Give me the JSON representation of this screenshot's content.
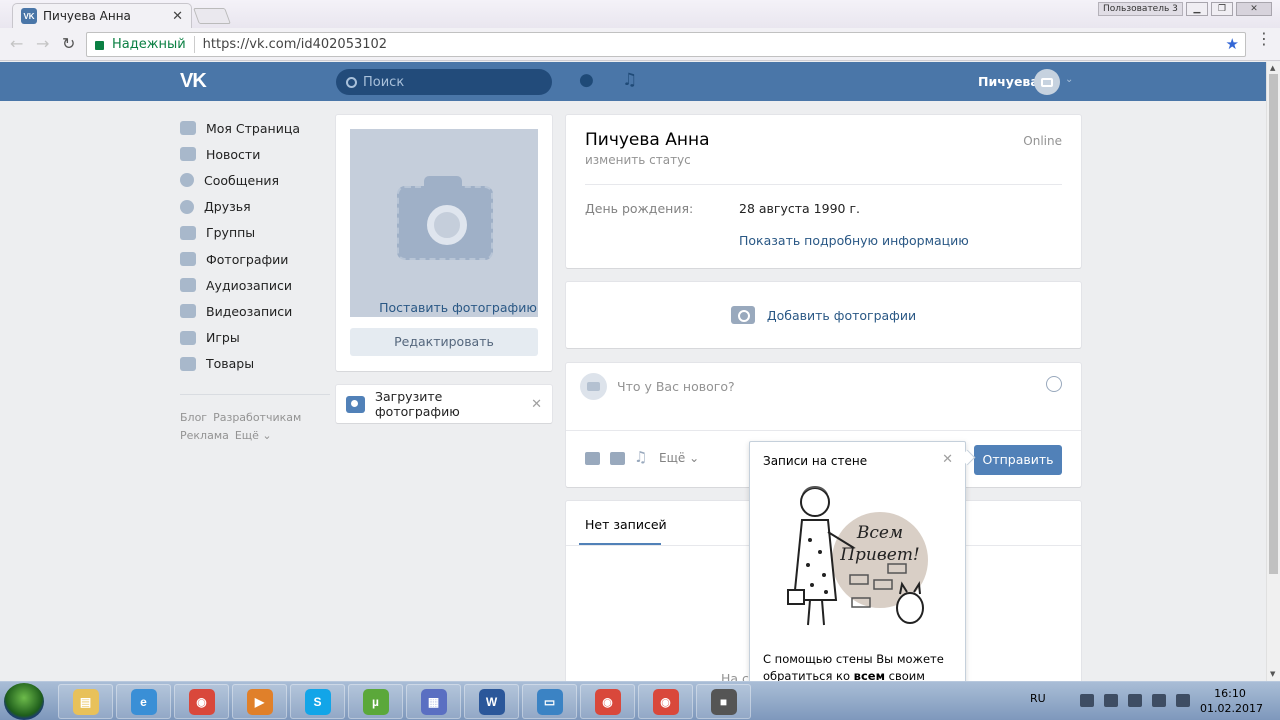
{
  "browser": {
    "tab_title": "Пичуева Анна",
    "tab_close": "✕",
    "favicon_text": "VK",
    "user_badge": "Пользователь 3",
    "secure_label": "Надежный",
    "url": "https://vk.com/id402053102",
    "back_icon": "←",
    "forward_icon": "→",
    "reload_icon": "↻",
    "star_icon": "★",
    "menu_icon": "⋮",
    "window_min": "▁",
    "window_max": "❐",
    "window_close": "✕"
  },
  "header": {
    "logo": "VK",
    "search_placeholder": "Поиск",
    "bell_icon": "🔔",
    "music_icon": "♫",
    "user_name": "Пичуева",
    "caret": "⌄"
  },
  "sidebar": {
    "items": [
      {
        "label": "Моя Страница",
        "icon": "home-icon"
      },
      {
        "label": "Новости",
        "icon": "news-icon"
      },
      {
        "label": "Сообщения",
        "icon": "messages-icon"
      },
      {
        "label": "Друзья",
        "icon": "friends-icon"
      },
      {
        "label": "Группы",
        "icon": "groups-icon"
      },
      {
        "label": "Фотографии",
        "icon": "photos-icon"
      },
      {
        "label": "Аудиозаписи",
        "icon": "music-icon"
      },
      {
        "label": "Видеозаписи",
        "icon": "video-icon"
      },
      {
        "label": "Игры",
        "icon": "games-icon"
      },
      {
        "label": "Товары",
        "icon": "market-icon"
      }
    ],
    "footer": {
      "blog": "Блог",
      "developers": "Разработчикам",
      "ads": "Реклама",
      "more": "Ещё ⌄"
    }
  },
  "photo_block": {
    "set_photo": "Поставить фотографию",
    "edit": "Редактировать"
  },
  "upload_block": {
    "label": "Загрузите фотографию",
    "close": "✕"
  },
  "profile": {
    "name": "Пичуева Анна",
    "status": "изменить статус",
    "online": "Online",
    "birthday_label": "День рождения:",
    "birthday_value": "28 августа 1990 г.",
    "show_more": "Показать подробную информацию"
  },
  "add_photos": {
    "label": "Добавить фотографии"
  },
  "post": {
    "placeholder": "Что у Вас нового?",
    "more": "Ещё ⌄",
    "send": "Отправить"
  },
  "wall": {
    "tab": "Нет записей",
    "empty_partial": "На ст"
  },
  "tooltip": {
    "title": "Записи на стене",
    "close": "✕",
    "sign_line1": "Всем",
    "sign_line2": "Привет!",
    "text_before": "С помощью стены Вы можете обратиться ко ",
    "text_bold": "всем",
    "text_after": " своим"
  },
  "taskbar": {
    "lang": "RU",
    "time": "16:10",
    "date": "01.02.2017",
    "apps": [
      {
        "name": "explorer",
        "color": "#e8c15a",
        "glyph": "▤"
      },
      {
        "name": "ie",
        "color": "#3a8fd6",
        "glyph": "e"
      },
      {
        "name": "chrome",
        "color": "#d9483b",
        "glyph": "◉"
      },
      {
        "name": "media-player",
        "color": "#e0802a",
        "glyph": "▶"
      },
      {
        "name": "skype",
        "color": "#12a5e8",
        "glyph": "S"
      },
      {
        "name": "utorrent",
        "color": "#5ba83a",
        "glyph": "µ"
      },
      {
        "name": "archiver",
        "color": "#5a6fc2",
        "glyph": "▦"
      },
      {
        "name": "word",
        "color": "#2b579a",
        "glyph": "W"
      },
      {
        "name": "display",
        "color": "#3b83c4",
        "glyph": "▭"
      },
      {
        "name": "chrome-2",
        "color": "#d9483b",
        "glyph": "◉"
      },
      {
        "name": "chrome-3",
        "color": "#d9483b",
        "glyph": "◉"
      },
      {
        "name": "camera",
        "color": "#555555",
        "glyph": "■"
      }
    ]
  }
}
